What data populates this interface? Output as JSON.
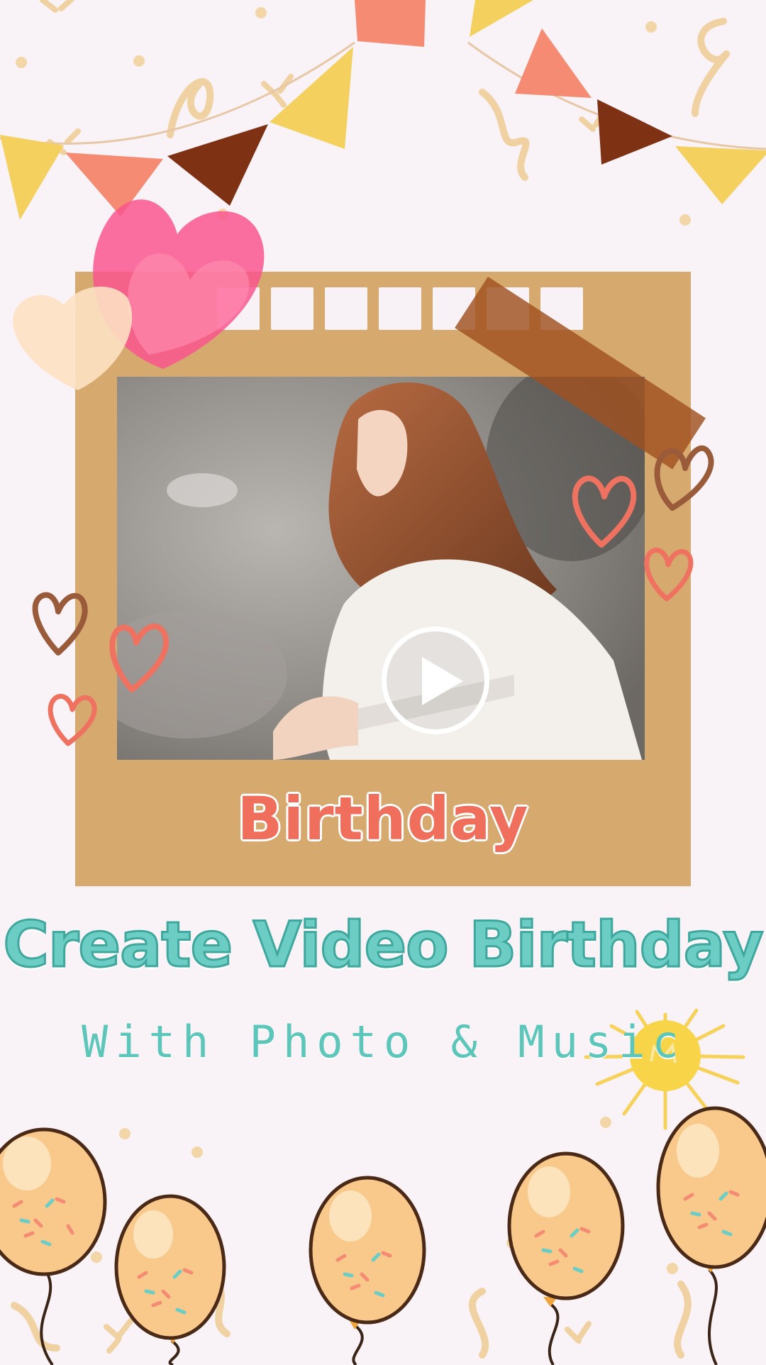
{
  "frame": {
    "label": "Birthday"
  },
  "headline": {
    "title": "Create Video Birthday",
    "subtitle": "With Photo & Music"
  },
  "video": {
    "play_icon": "play-icon"
  },
  "colors": {
    "background": "#f9f3f8",
    "frame": "#d6a96f",
    "label": "#ef6f5c",
    "title": "#6ccdc4",
    "balloon": "#f9c98c",
    "tape": "#a0501f"
  }
}
